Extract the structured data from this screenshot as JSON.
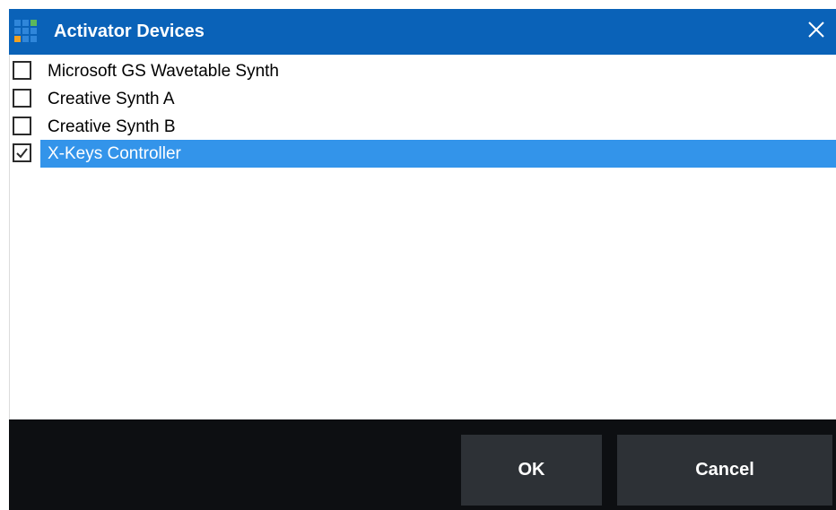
{
  "window": {
    "title": "Activator Devices",
    "accent_color": "#0a62b8",
    "selection_color": "#3394ea"
  },
  "icons": {
    "app": "grid-logo-icon",
    "close": "close-icon",
    "checkbox_checked": "checkmark-icon"
  },
  "devices": [
    {
      "label": "Microsoft GS Wavetable Synth",
      "checked": false,
      "selected": false
    },
    {
      "label": "Creative Synth A",
      "checked": false,
      "selected": false
    },
    {
      "label": "Creative Synth B",
      "checked": false,
      "selected": false
    },
    {
      "label": "X-Keys Controller",
      "checked": true,
      "selected": true
    }
  ],
  "footer": {
    "ok_label": "OK",
    "cancel_label": "Cancel"
  }
}
